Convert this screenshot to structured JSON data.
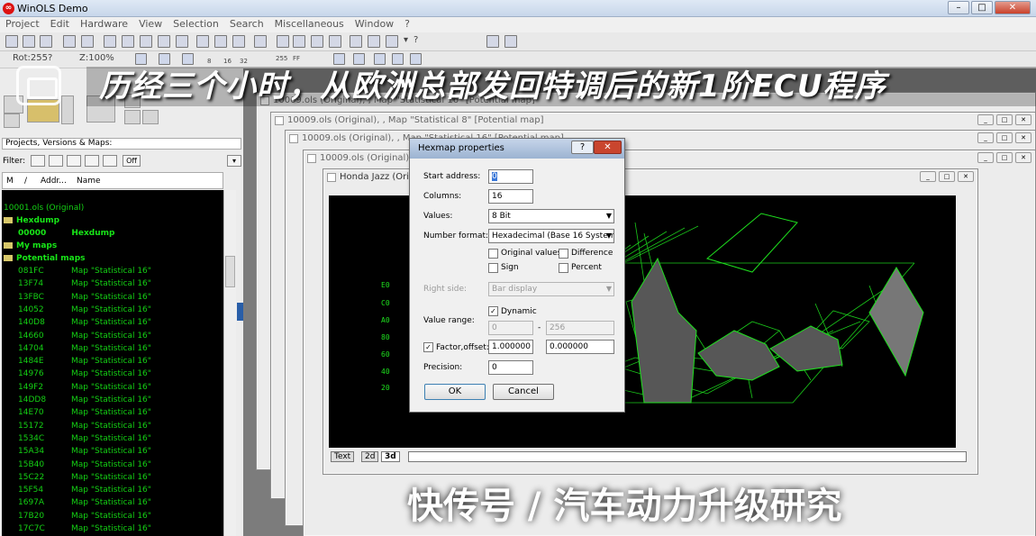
{
  "window": {
    "title": "WinOLS Demo",
    "logo": "winols-logo",
    "controls": [
      "–",
      "□",
      "✕"
    ]
  },
  "menu": [
    "Project",
    "Edit",
    "Hardware",
    "View",
    "Selection",
    "Search",
    "Miscellaneous",
    "Window",
    "?"
  ],
  "toolbar": {
    "rot_label": "Rot:255?",
    "zoom_label": "Z:100%",
    "bits": [
      "8",
      "16",
      "32",
      "FF",
      "255"
    ],
    "question": "?"
  },
  "left_panel": {
    "selector": "Projects, Versions & Maps:",
    "filter_label": "Filter:",
    "filter_off": "Off",
    "columns": [
      "M",
      "/",
      "Addr...",
      "Name"
    ],
    "tree": [
      {
        "text": "10001.ols (Original)",
        "kind": "root"
      },
      {
        "text": "Hexdump",
        "kind": "folder"
      },
      {
        "addr": "00000",
        "name": "Hexdump",
        "kind": "item"
      },
      {
        "text": "My maps",
        "kind": "folder"
      },
      {
        "text": "Potential maps",
        "kind": "folder"
      }
    ],
    "maps": [
      {
        "addr": "081FC",
        "name": "Map \"Statistical 16\""
      },
      {
        "addr": "13F74",
        "name": "Map \"Statistical 16\""
      },
      {
        "addr": "13FBC",
        "name": "Map \"Statistical 16\""
      },
      {
        "addr": "14052",
        "name": "Map \"Statistical 16\""
      },
      {
        "addr": "140D8",
        "name": "Map \"Statistical 16\""
      },
      {
        "addr": "14660",
        "name": "Map \"Statistical 16\""
      },
      {
        "addr": "14704",
        "name": "Map \"Statistical 16\""
      },
      {
        "addr": "1484E",
        "name": "Map \"Statistical 16\""
      },
      {
        "addr": "14976",
        "name": "Map \"Statistical 16\""
      },
      {
        "addr": "149F2",
        "name": "Map \"Statistical 16\""
      },
      {
        "addr": "14DD8",
        "name": "Map \"Statistical 16\""
      },
      {
        "addr": "14E70",
        "name": "Map \"Statistical 16\""
      },
      {
        "addr": "15172",
        "name": "Map \"Statistical 16\""
      },
      {
        "addr": "1534C",
        "name": "Map \"Statistical 16\""
      },
      {
        "addr": "15A34",
        "name": "Map \"Statistical 16\""
      },
      {
        "addr": "15B40",
        "name": "Map \"Statistical 16\""
      },
      {
        "addr": "15C22",
        "name": "Map \"Statistical 16\""
      },
      {
        "addr": "15F54",
        "name": "Map \"Statistical 16\""
      },
      {
        "addr": "1697A",
        "name": "Map \"Statistical 16\""
      },
      {
        "addr": "17B20",
        "name": "Map \"Statistical 16\""
      },
      {
        "addr": "17C7C",
        "name": "Map \"Statistical 16\""
      }
    ]
  },
  "child_windows": [
    {
      "title": "10009.ols (Original), , Map \"Statistical 16\"   [Potential map]"
    },
    {
      "title": "10009.ols (Original), , Map \"Statistical 8\"   [Potential map]"
    },
    {
      "title": "10009.ols (Original), , Map \"Statistical 16\"   [Potential map]"
    },
    {
      "title": "10009.ols (Original), , Map \"Statistical 16\"   [Potential map]"
    },
    {
      "title": "Honda Jazz (Original), , Map \"Statistical 16\"   [Potential map]"
    }
  ],
  "plot": {
    "y_labels": [
      "E0",
      "C0",
      "A0",
      "80",
      "60",
      "40",
      "20"
    ],
    "tabs": [
      "Text",
      "2d",
      "3d"
    ],
    "active_tab": "3d",
    "green": "#1ee01e"
  },
  "dialog": {
    "title": "Hexmap properties",
    "help": "?",
    "close": "✕",
    "start_address_label": "Start address:",
    "start_address": "0",
    "columns_label": "Columns:",
    "columns": "16",
    "values_label": "Values:",
    "values": "8 Bit",
    "number_format_label": "Number format:",
    "number_format": "Hexadecimal  (Base 16 System)",
    "original_values": "Original values",
    "difference": "Difference",
    "sign": "Sign",
    "percent": "Percent",
    "right_side_label": "Right side:",
    "right_side": "Bar display",
    "dynamic_label": "Dynamic",
    "value_range_label": "Value range:",
    "range_from": "0",
    "range_sep": "-",
    "range_to": "256",
    "factor_offset_label": "Factor,offset:",
    "factor": "1.000000",
    "offset": "0.000000",
    "precision_label": "Precision:",
    "precision": "0",
    "ok": "OK",
    "cancel": "Cancel"
  },
  "overlay": {
    "banner": "历经三个小时，从欧洲总部发回特调后的新1阶ECU程序",
    "footer": "快传号 / 汽车动力升级研究"
  }
}
